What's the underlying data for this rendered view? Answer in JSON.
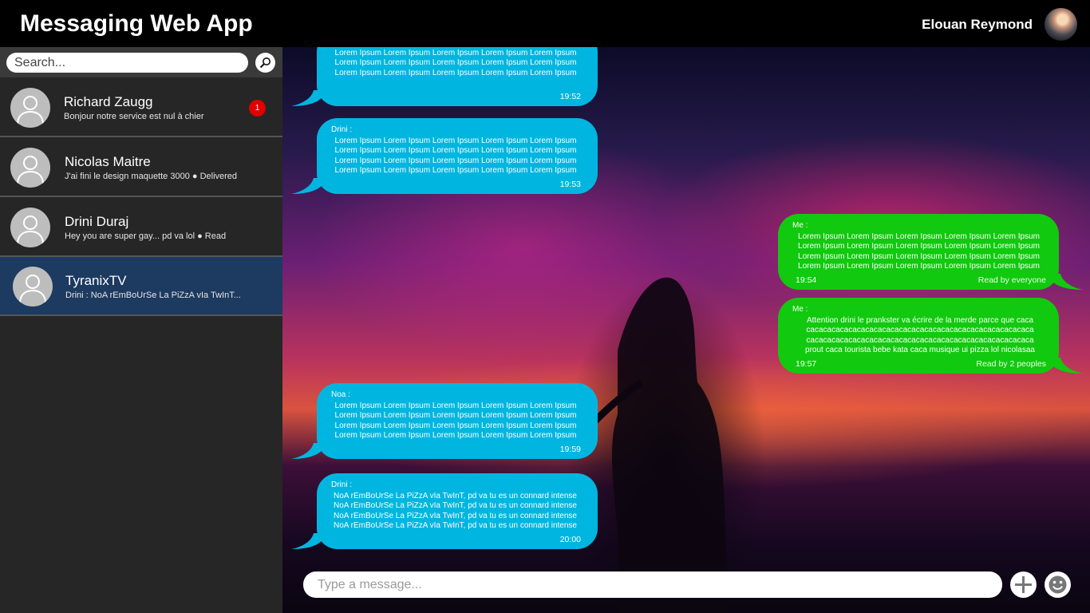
{
  "header": {
    "app_title": "Messaging Web App",
    "user_name": "Elouan Reymond"
  },
  "sidebar": {
    "search_placeholder": "Search...",
    "conversations": [
      {
        "name": "Richard Zaugg",
        "preview": "Bonjour notre service est nul à chier",
        "unread": "1"
      },
      {
        "name": "Nicolas Maitre",
        "preview": "J'ai fini le design maquette 3000 ● Delivered"
      },
      {
        "name": "Drini Duraj",
        "preview": "Hey you are super gay... pd va lol ● Read"
      },
      {
        "name": "TyranixTV",
        "preview": "Drini : NoA rEmBoUrSe La PiZzA vIa TwInT...",
        "active": true
      }
    ]
  },
  "messages": [
    {
      "author": "",
      "text": "Lorem Ipsum Lorem Ipsum Lorem Ipsum Lorem Ipsum Lorem Ipsum\nLorem Ipsum Lorem Ipsum Lorem Ipsum Lorem Ipsum Lorem Ipsum\nLorem Ipsum Lorem Ipsum Lorem Ipsum Lorem Ipsum Lorem Ipsum\nLorem Ipsum Lorem Ipsum Lorem Ipsum Lorem Ipsum Lorem Ipsum\nLorem Ipsum Lorem Ipsum Lorem Ipsum Lorem Ipsum Lorem Ipsum",
      "time": "19:52"
    },
    {
      "author": "Drini :",
      "text": "Lorem Ipsum Lorem Ipsum Lorem Ipsum Lorem Ipsum Lorem Ipsum\nLorem Ipsum Lorem Ipsum Lorem Ipsum Lorem Ipsum Lorem Ipsum\nLorem Ipsum Lorem Ipsum Lorem Ipsum Lorem Ipsum Lorem Ipsum\nLorem Ipsum Lorem Ipsum Lorem Ipsum Lorem Ipsum Lorem Ipsum",
      "time": "19:53"
    },
    {
      "author": "Me :",
      "text": "Lorem Ipsum Lorem Ipsum Lorem Ipsum Lorem Ipsum Lorem Ipsum\nLorem Ipsum Lorem Ipsum Lorem Ipsum Lorem Ipsum Lorem Ipsum\nLorem Ipsum Lorem Ipsum Lorem Ipsum Lorem Ipsum Lorem Ipsum\nLorem Ipsum Lorem Ipsum Lorem Ipsum Lorem Ipsum Lorem Ipsum",
      "time": "19:54",
      "status": "Read by everyone"
    },
    {
      "author": "Me :",
      "text": "Attention drini le prankster va écrire de la merde parce que caca\ncacacacacacacacacacacacacacacacacacacacacacacacacacaca\ncacacacacacacacacacacacacacacacacacacacacacacacacacaca\nprout caca tourista bebe kata caca musique ui pizza lol nicolasaa",
      "time": "19:57",
      "status": "Read by 2 peoples"
    },
    {
      "author": "Noa :",
      "text": "Lorem Ipsum Lorem Ipsum Lorem Ipsum Lorem Ipsum Lorem Ipsum\nLorem Ipsum Lorem Ipsum Lorem Ipsum Lorem Ipsum Lorem Ipsum\nLorem Ipsum Lorem Ipsum Lorem Ipsum Lorem Ipsum Lorem Ipsum\nLorem Ipsum Lorem Ipsum Lorem Ipsum Lorem Ipsum Lorem Ipsum",
      "time": "19:59"
    },
    {
      "author": "Drini :",
      "text": "NoA rEmBoUrSe La PiZzA vIa TwInT, pd va tu es un connard intense\nNoA rEmBoUrSe La PiZzA vIa TwInT, pd va tu es un connard intense\nNoA rEmBoUrSe La PiZzA vIa TwInT, pd va tu es un connard intense\nNoA rEmBoUrSe La PiZzA vIa TwInT, pd va tu es un connard intense",
      "time": "20:00"
    }
  ],
  "composer": {
    "placeholder": "Type a message..."
  },
  "icons": {
    "search": "search-icon",
    "add": "plus-icon",
    "emoji": "smiley-icon",
    "avatar": "person-icon"
  },
  "colors": {
    "incoming_bubble": "#00b6e0",
    "outgoing_bubble": "#11c90e",
    "active_conversation": "#1d3a60",
    "unread_badge": "#e00000"
  }
}
